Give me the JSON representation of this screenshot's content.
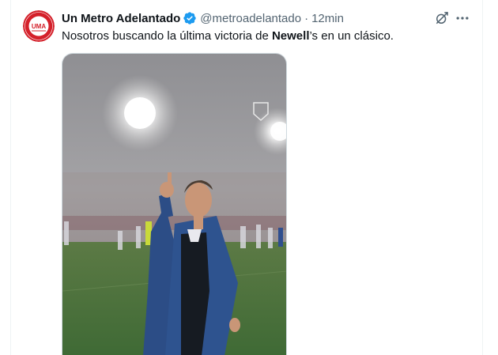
{
  "tweet": {
    "author_name": "Un Metro Adelantado",
    "handle": "@metroadelantado",
    "separator": "·",
    "time": "12min",
    "text_before": "Nosotros buscando la última victoria de ",
    "text_bold": "Newell",
    "text_after": "’s en un clásico.",
    "verified": true
  },
  "avatar": {
    "initials": "UMA",
    "ring_text_top": "UN METRO",
    "ring_text_bottom": "ADELANTADO",
    "color": "#d4202a"
  },
  "actions": {
    "grok_icon": "grok-icon",
    "more_icon": "more-horizontal-icon"
  },
  "colors": {
    "verified": "#1d9bf0",
    "text": "#0f1419",
    "secondary": "#536471"
  }
}
